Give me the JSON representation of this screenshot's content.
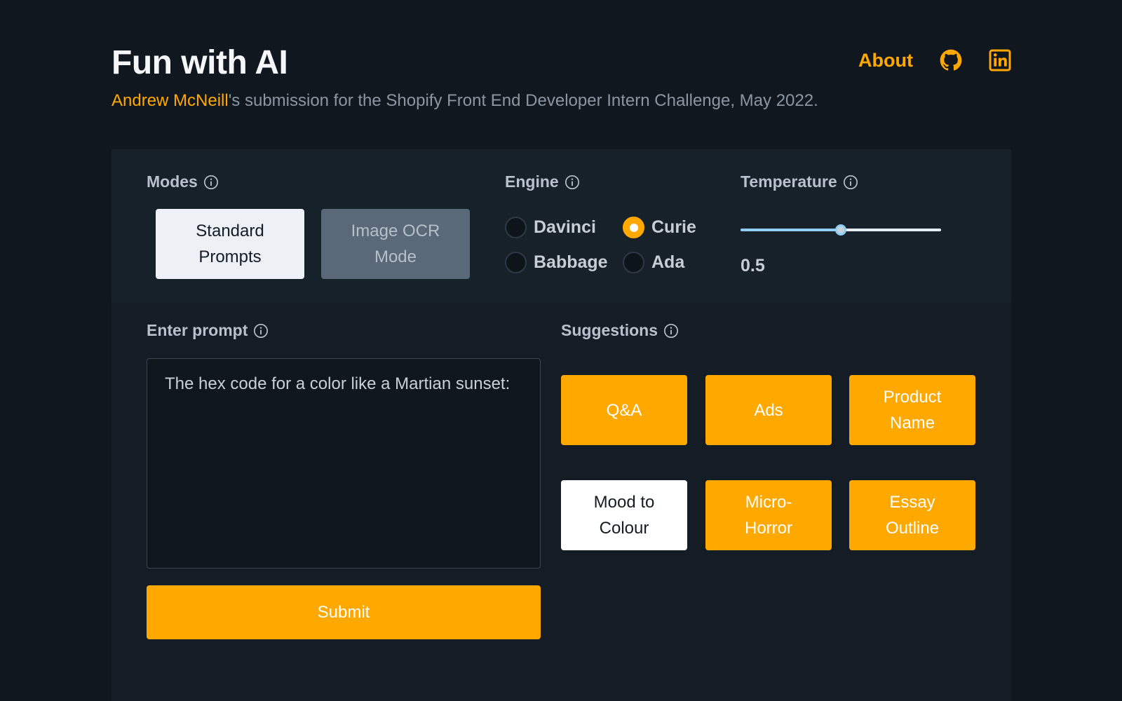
{
  "header": {
    "title": "Fun with AI",
    "author_name": "Andrew McNeill",
    "subtitle_rest": "'s submission for the Shopify Front End Developer Intern Challenge, May 2022.",
    "nav": {
      "about_label": "About",
      "github_icon": "github-icon",
      "linkedin_icon": "linkedin-icon"
    }
  },
  "modes": {
    "label": "Modes",
    "standard_label": "Standard\nPrompts",
    "ocr_label": "Image OCR\nMode",
    "selected": "Standard Prompts"
  },
  "engine": {
    "label": "Engine",
    "options": [
      "Davinci",
      "Curie",
      "Babbage",
      "Ada"
    ],
    "selected": "Curie"
  },
  "temperature": {
    "label": "Temperature",
    "value": "0.5",
    "fraction": 0.5
  },
  "prompt": {
    "label": "Enter prompt",
    "value": "The hex code for a color like a Martian sunset:"
  },
  "submit_label": "Submit",
  "suggestions": {
    "label": "Suggestions",
    "items": [
      "Q&A",
      "Ads",
      "Product\nName",
      "Mood to\nColour",
      "Micro-\nHorror",
      "Essay\nOutline"
    ],
    "selected": "Mood to Colour"
  },
  "colors": {
    "accent": "#ffa800",
    "background": "#10171e",
    "panel": "#141d25",
    "slider": "#90cdf4"
  }
}
